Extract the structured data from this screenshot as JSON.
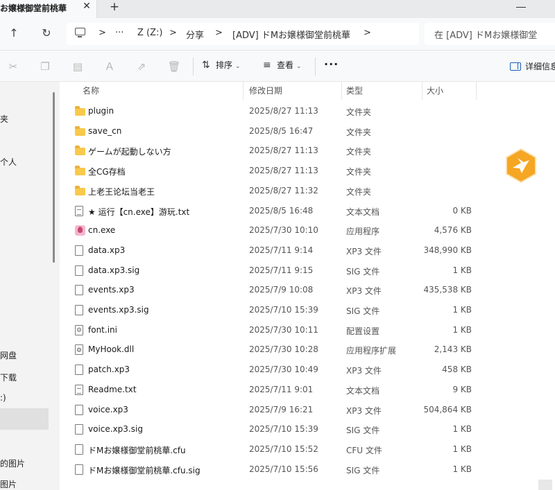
{
  "tab": {
    "title": "お嬢様御堂前桃華",
    "close": "✕",
    "new_tab": "+"
  },
  "nav": {
    "back": "←",
    "up": "↑",
    "refresh": "↻"
  },
  "address": {
    "crumbs": [
      ">",
      "···",
      "Z (Z:)",
      ">",
      "分享",
      ">",
      "[ADV] ドMお嬢様御堂前桃華",
      ">"
    ]
  },
  "search": {
    "placeholder": "在 [ADV] ドMお嬢様御堂"
  },
  "commands": {
    "sort_label": "排序",
    "view_label": "查看",
    "more": "···",
    "details_label": "详细信息"
  },
  "sidebar": {
    "items": [
      {
        "label": "夹"
      },
      {
        "label": "个人"
      },
      {
        "label": "网盘"
      },
      {
        "label": "下载"
      },
      {
        "label": ":)"
      },
      {
        "label": "的图片"
      },
      {
        "label": "图片"
      }
    ]
  },
  "columns": {
    "name": "名称",
    "date": "修改日期",
    "type": "类型",
    "size": "大小",
    "sort_arrow": "^"
  },
  "files": [
    {
      "icon": "folder",
      "name": "plugin",
      "date": "2025/8/27 11:13",
      "type": "文件夹",
      "size": ""
    },
    {
      "icon": "folder",
      "name": "save_cn",
      "date": "2025/8/5 16:47",
      "type": "文件夹",
      "size": ""
    },
    {
      "icon": "folder",
      "name": "ゲームが起動しない方",
      "date": "2025/8/27 11:13",
      "type": "文件夹",
      "size": ""
    },
    {
      "icon": "folder",
      "name": "全CG存档",
      "date": "2025/8/27 11:13",
      "type": "文件夹",
      "size": ""
    },
    {
      "icon": "folder",
      "name": "上老王论坛当老王",
      "date": "2025/8/27 11:32",
      "type": "文件夹",
      "size": ""
    },
    {
      "icon": "text",
      "name": "★ 运行【cn.exe】游玩.txt",
      "date": "2025/8/5 16:48",
      "type": "文本文档",
      "size": "0 KB"
    },
    {
      "icon": "app",
      "name": "cn.exe",
      "date": "2025/7/30 10:10",
      "type": "应用程序",
      "size": "4,576 KB"
    },
    {
      "icon": "file",
      "name": "data.xp3",
      "date": "2025/7/11 9:14",
      "type": "XP3 文件",
      "size": "348,990 KB"
    },
    {
      "icon": "file",
      "name": "data.xp3.sig",
      "date": "2025/7/11 9:15",
      "type": "SIG 文件",
      "size": "1 KB"
    },
    {
      "icon": "file",
      "name": "events.xp3",
      "date": "2025/7/9 10:08",
      "type": "XP3 文件",
      "size": "435,538 KB"
    },
    {
      "icon": "file",
      "name": "events.xp3.sig",
      "date": "2025/7/10 15:39",
      "type": "SIG 文件",
      "size": "1 KB"
    },
    {
      "icon": "config",
      "name": "font.ini",
      "date": "2025/7/30 10:11",
      "type": "配置设置",
      "size": "1 KB"
    },
    {
      "icon": "dll",
      "name": "MyHook.dll",
      "date": "2025/7/30 10:28",
      "type": "应用程序扩展",
      "size": "2,143 KB"
    },
    {
      "icon": "file",
      "name": "patch.xp3",
      "date": "2025/7/30 10:49",
      "type": "XP3 文件",
      "size": "458 KB"
    },
    {
      "icon": "text",
      "name": "Readme.txt",
      "date": "2025/7/11 9:01",
      "type": "文本文档",
      "size": "9 KB"
    },
    {
      "icon": "file",
      "name": "voice.xp3",
      "date": "2025/7/9 16:21",
      "type": "XP3 文件",
      "size": "504,864 KB"
    },
    {
      "icon": "file",
      "name": "voice.xp3.sig",
      "date": "2025/7/10 15:39",
      "type": "SIG 文件",
      "size": "1 KB"
    },
    {
      "icon": "file",
      "name": "ドMお嬢様御堂前桃華.cfu",
      "date": "2025/7/10 15:52",
      "type": "CFU 文件",
      "size": "1 KB"
    },
    {
      "icon": "file",
      "name": "ドMお嬢様御堂前桃華.cfu.sig",
      "date": "2025/7/10 15:56",
      "type": "SIG 文件",
      "size": "1 KB"
    }
  ],
  "colors": {
    "folder": "#f8c94b",
    "accent": "#1a5fb4",
    "badge": "#f5a623"
  }
}
